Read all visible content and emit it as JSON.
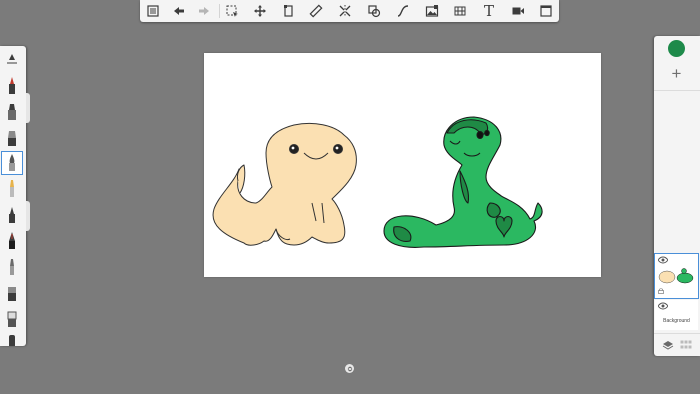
{
  "toolbar": {
    "items": [
      "menu-icon",
      "undo-icon",
      "redo-icon",
      "selection-icon",
      "transform-icon",
      "copy-paste-icon",
      "ruler-icon",
      "symmetry-icon",
      "shape-icon",
      "curve-icon",
      "image-icon",
      "perspective-icon",
      "text-icon",
      "video-icon",
      "canvas-icon"
    ],
    "text_label": "T"
  },
  "brushes": [
    "brush-size-slider",
    "pencil",
    "marker",
    "airbrush",
    "paintbrush",
    "felt-pen",
    "ink-pen",
    "fountain-pen",
    "chisel-pen",
    "smudge",
    "eraser",
    "block-tool"
  ],
  "selected_brush": "paintbrush",
  "colors": {
    "current": "#1e8a4a",
    "lizard_fill": "#fbe0b2",
    "snake_fill": "#2bb861",
    "snake_spots": "#1f8a45",
    "accent": "#4a8fd8"
  },
  "layers": {
    "layer1_label": "",
    "background_label": "Background"
  }
}
